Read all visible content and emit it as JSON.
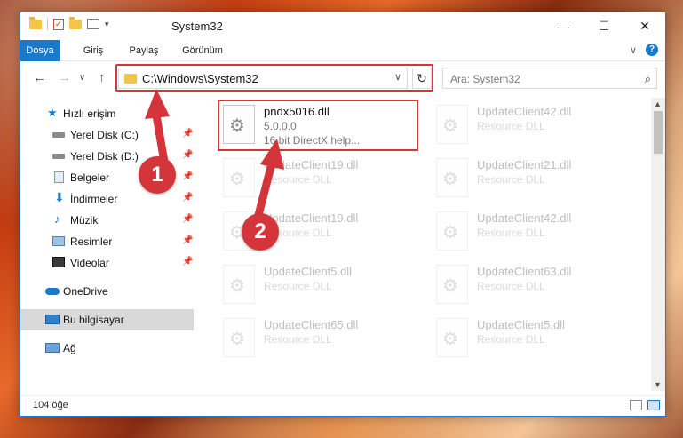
{
  "window": {
    "title": "System32",
    "minimize": "—",
    "maximize": "☐",
    "close": "✕"
  },
  "ribbon": {
    "tabs": [
      "Dosya",
      "Giriş",
      "Paylaş",
      "Görünüm"
    ],
    "expand": "∨",
    "help": "?"
  },
  "address": {
    "back": "←",
    "forward": "→",
    "recent": "∨",
    "up": "↑",
    "path": "C:\\Windows\\System32",
    "dropdown": "∨",
    "refresh": "↻",
    "search_placeholder": "Ara: System32",
    "search_icon": "⌕"
  },
  "sidebar": {
    "items": [
      {
        "label": "Hızlı erişim",
        "icon": "star-icon",
        "pinned": false
      },
      {
        "label": "Yerel Disk (C:)",
        "icon": "drive-icon",
        "pinned": true
      },
      {
        "label": "Yerel Disk (D:)",
        "icon": "drive-icon",
        "pinned": true
      },
      {
        "label": "Belgeler",
        "icon": "documents-icon",
        "pinned": true
      },
      {
        "label": "İndirmeler",
        "icon": "download-icon",
        "pinned": true
      },
      {
        "label": "Müzik",
        "icon": "music-icon",
        "pinned": true
      },
      {
        "label": "Resimler",
        "icon": "pictures-icon",
        "pinned": true
      },
      {
        "label": "Videolar",
        "icon": "videos-icon",
        "pinned": true
      },
      {
        "label": "OneDrive",
        "icon": "cloud-icon",
        "pinned": false
      },
      {
        "label": "Bu bilgisayar",
        "icon": "computer-icon",
        "pinned": false
      },
      {
        "label": "Ağ",
        "icon": "network-icon",
        "pinned": false
      }
    ],
    "pin_glyph": "📌"
  },
  "files": {
    "highlighted": {
      "name": "pndx5016.dll",
      "version": "5.0.0.0",
      "description": "16 bit DirectX help..."
    },
    "faded": [
      {
        "name": "UpdateClient42.dll",
        "description": "Resource DLL"
      },
      {
        "name": "UpdateClient19.dll",
        "description": "Resource DLL"
      },
      {
        "name": "UpdateClient21.dll",
        "description": "Resource DLL"
      },
      {
        "name": "UpdateClient19.dll",
        "description": "Resource DLL"
      },
      {
        "name": "UpdateClient42.dll",
        "description": "Resource DLL"
      },
      {
        "name": "UpdateClient5.dll",
        "description": "Resource DLL"
      },
      {
        "name": "UpdateClient63.dll",
        "description": "Resource DLL"
      },
      {
        "name": "UpdateClient65.dll",
        "description": "Resource DLL"
      },
      {
        "name": "UpdateClient5.dll",
        "description": "Resource DLL"
      }
    ]
  },
  "scrollbar": {
    "up": "▲",
    "down": "▼"
  },
  "status": {
    "item_count": "104 öğe"
  },
  "annotations": {
    "step1": "1",
    "step2": "2",
    "color": "#d4353b"
  },
  "colors": {
    "accent": "#1979ca",
    "highlight_red": "#d4353b"
  }
}
